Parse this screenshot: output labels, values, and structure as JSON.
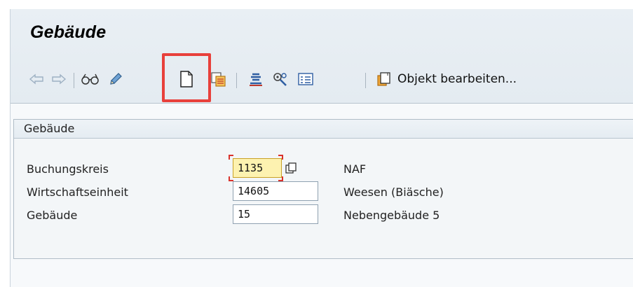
{
  "header": {
    "title": "Gebäude"
  },
  "toolbar": {
    "back_icon": "arrow-left-icon",
    "forward_icon": "arrow-right-icon",
    "display_icon": "glasses-icon",
    "change_icon": "pencil-icon",
    "create_icon": "blank-document-icon",
    "copy_icon": "copy-document-icon",
    "hierarchy_icon": "hierarchy-lines-icon",
    "tools_icon": "wrench-gear-icon",
    "list_icon": "list-icon",
    "edit_object_label": "Objekt bearbeiten..."
  },
  "panel": {
    "header": "Gebäude",
    "fields": [
      {
        "label": "Buchungskreis",
        "value": "1135",
        "description": "NAF",
        "active": true
      },
      {
        "label": "Wirtschaftseinheit",
        "value": "14605",
        "description": "Weesen (Biäsche)"
      },
      {
        "label": "Gebäude",
        "value": "15",
        "description": "Nebengebäude 5"
      }
    ]
  },
  "colors": {
    "highlight": "#e8403b",
    "active_field": "#fdf2b0",
    "titlebar": "#e6edf3"
  }
}
